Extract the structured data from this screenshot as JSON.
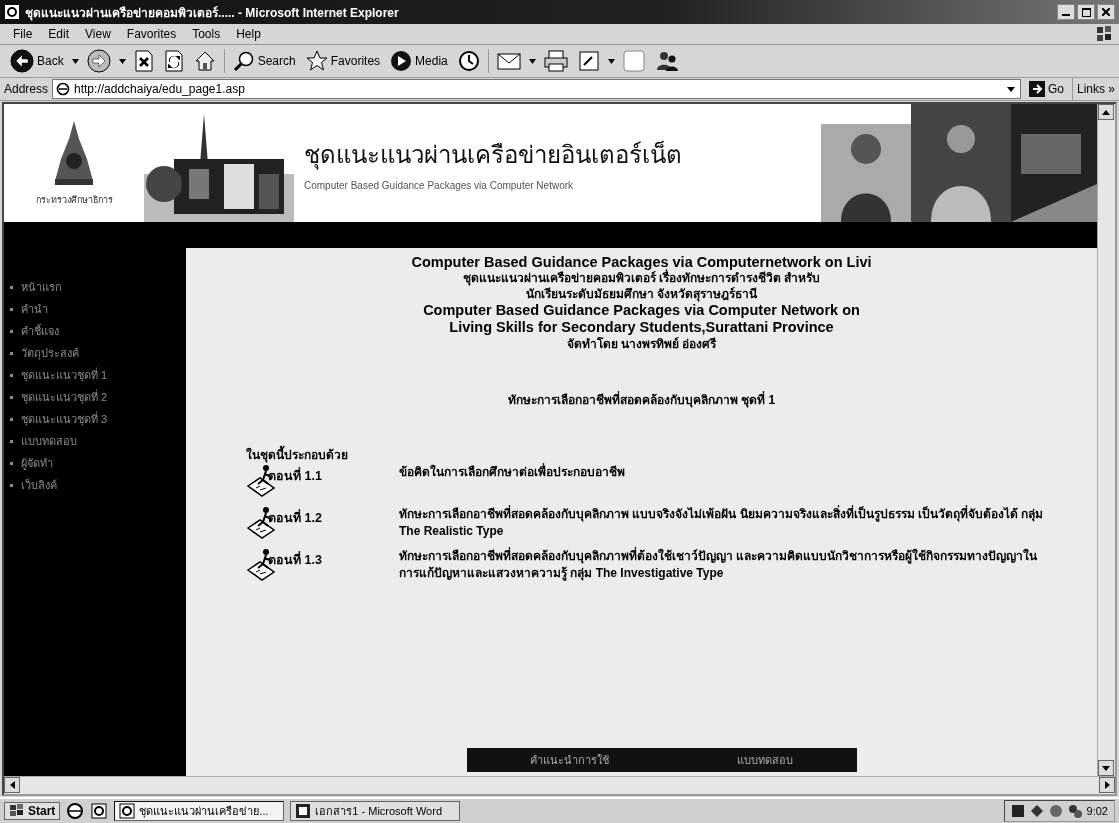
{
  "window": {
    "title": "ชุดแนะแนวผ่านเครือข่ายคอมพิวเตอร์..... - Microsoft Internet Explorer"
  },
  "menu": [
    "File",
    "Edit",
    "View",
    "Favorites",
    "Tools",
    "Help"
  ],
  "toolbar": {
    "back": "Back",
    "search": "Search",
    "favorites": "Favorites",
    "media": "Media"
  },
  "address_bar": {
    "label": "Address",
    "url": "http://addchaiya/edu_page1.asp",
    "go": "Go",
    "links": "Links »"
  },
  "header": {
    "crest_caption": "กระทรวงศึกษาธิการ",
    "title": "ชุดแนะแนวผ่านเครือข่ายอินเตอร์เน็ต",
    "subtitle": "Computer Based Guidance Packages via Computer Network"
  },
  "sidebar": {
    "items": [
      "หน้าแรก",
      "คำนำ",
      "คำชี้แจง",
      "วัตถุประสงค์",
      "ชุดแนะแนวชุดที่ 1",
      "ชุดแนะแนวชุดที่ 2",
      "ชุดแนะแนวชุดที่ 3",
      "แบบทดสอบ",
      "ผู้จัดทำ",
      "เว็บลิงค์"
    ]
  },
  "content": {
    "heading_en": "Computer Based Guidance Packages via Computernetwork on Livi",
    "heading_th": [
      "ชุดแนะแนวผ่านเครือข่ายคอมพิวเตอร์ เรื่องทักษะการดำรงชีวิต สำหรับ",
      "นักเรียนระดับมัธยมศึกษา จังหวัดสุราษฎร์ธานี"
    ],
    "title_en": [
      "Computer Based Guidance Packages via Computer Network on",
      "Living Skills  for Secondary Students,Surattani Province"
    ],
    "author": "จัดทำโดย นางพรทิพย์ อ่องศรี",
    "set_title": "ทักษะการเลือกอาชีพที่สอดคล้องกับบุคลิกภาพ ชุดที่ 1",
    "includes_label": "ในชุดนี้ประกอบด้วย",
    "parts": [
      {
        "label": "ตอนที่ 1.1",
        "text": "ข้อคิดในการเลือกศึกษาต่อเพื่อประกอบอาชีพ"
      },
      {
        "label": "ตอนที่ 1.2",
        "text": "ทักษะการเลือกอาชีพที่สอดคล้องกับบุคลิกภาพ แบบจริงจังไม่เพ้อฝัน นิยมความจริงและสิ่งที่เป็นรูปธรรม เป็นวัตถุที่จับต้องได้  กลุ่ม The Realistic Type"
      },
      {
        "label": "ตอนที่ 1.3",
        "text": "ทักษะการเลือกอาชีพที่สอดคล้องกับบุคลิกภาพที่ต้องใช้เชาว์ปัญญา และความคิดแบบนักวิชาการหรือผู้ใช้กิจกรรมทางปัญญาในการแก้ปัญหาและแสวงหาความรู้ กลุ่ม The Investigative Type"
      }
    ],
    "footer_links": [
      "คำแนะนำการใช้",
      "แบบทดสอบ"
    ]
  },
  "taskbar": {
    "start": "Start",
    "tasks": [
      {
        "label": "ชุดแนะแนวผ่านเครือข่าย...",
        "selected": true
      },
      {
        "label": "เอกสาร1 - Microsoft Word",
        "selected": false
      }
    ],
    "clock": "9:02"
  }
}
